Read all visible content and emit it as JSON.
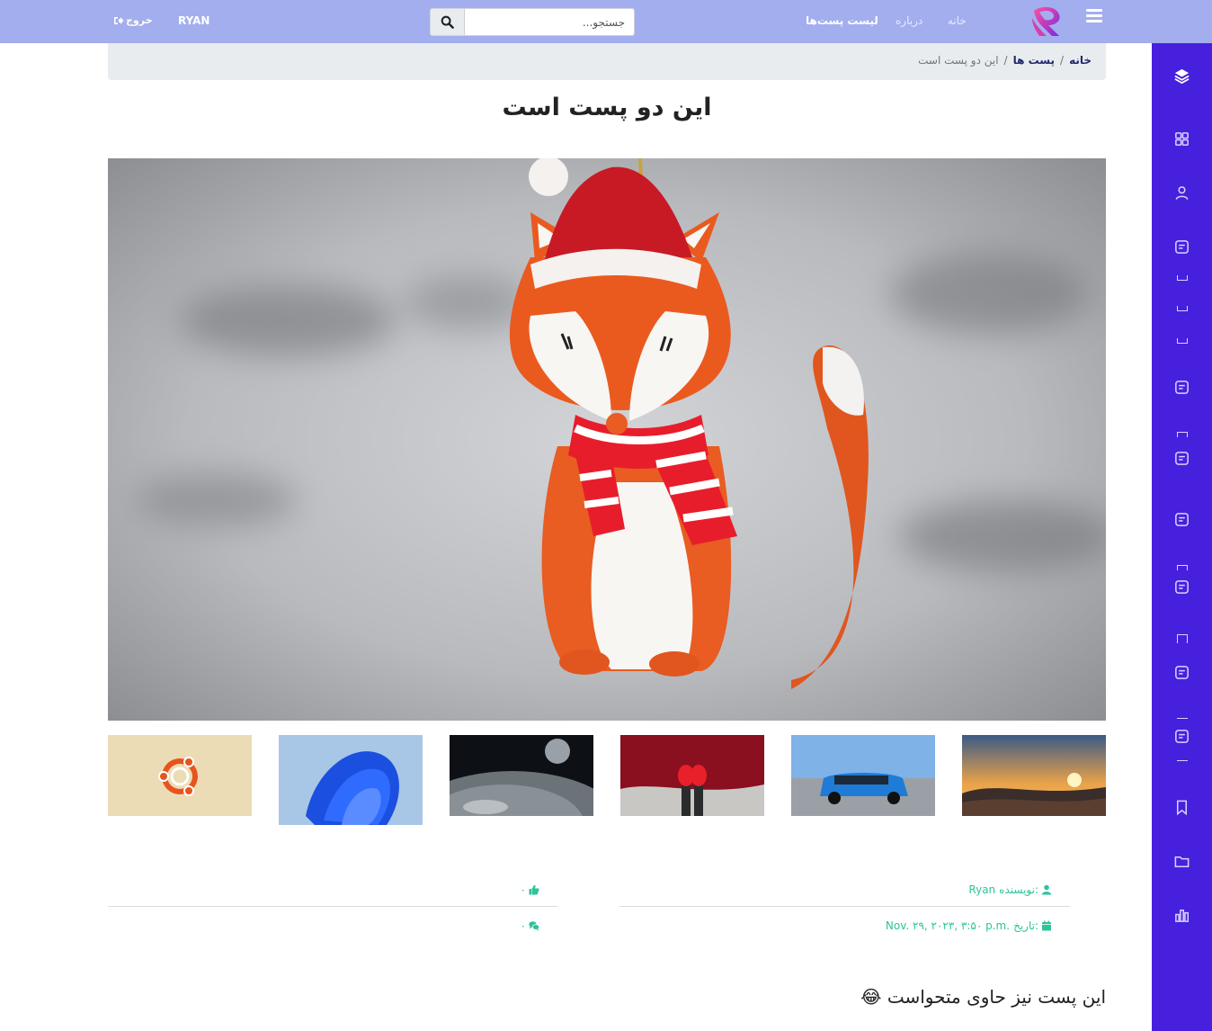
{
  "nav": {
    "home": "خانه",
    "about": "درباره",
    "posts_list": "لیست پست‌ها",
    "user": "RYAN",
    "logout": "خروج"
  },
  "search": {
    "placeholder": "جستجو..."
  },
  "breadcrumb": {
    "home": "خانه",
    "posts": "پست ها",
    "separator": "/",
    "current": "این دو پست است"
  },
  "post": {
    "title": "این دو پست است",
    "author_label": "نویسنده:",
    "author": "Ryan",
    "date_label": "تاریخ:",
    "date": "Nov. ۲۹, ۲۰۲۳, ۳:۵۰ p.m.",
    "likes": "۰",
    "comments": "۰",
    "body": "این پست نیز حاوی متحواست 😂"
  },
  "colors": {
    "topbar": "#a3aeee",
    "sidebar": "#4720dd",
    "accent_green": "#2fc39a",
    "breadcrumb_bg": "#e9ecef"
  },
  "sidebar_icons": [
    "layers-icon",
    "grid-icon",
    "user-icon",
    "note-icon",
    "note-icon",
    "note-icon",
    "note-icon",
    "note-icon",
    "note-icon",
    "note-icon",
    "bookmark-icon",
    "folder-icon",
    "bar-chart-icon"
  ],
  "thumbnails": [
    "ubuntu-logo",
    "windows-bloom",
    "planet-space",
    "red-shoes",
    "blue-suv",
    "sunset-valley"
  ]
}
